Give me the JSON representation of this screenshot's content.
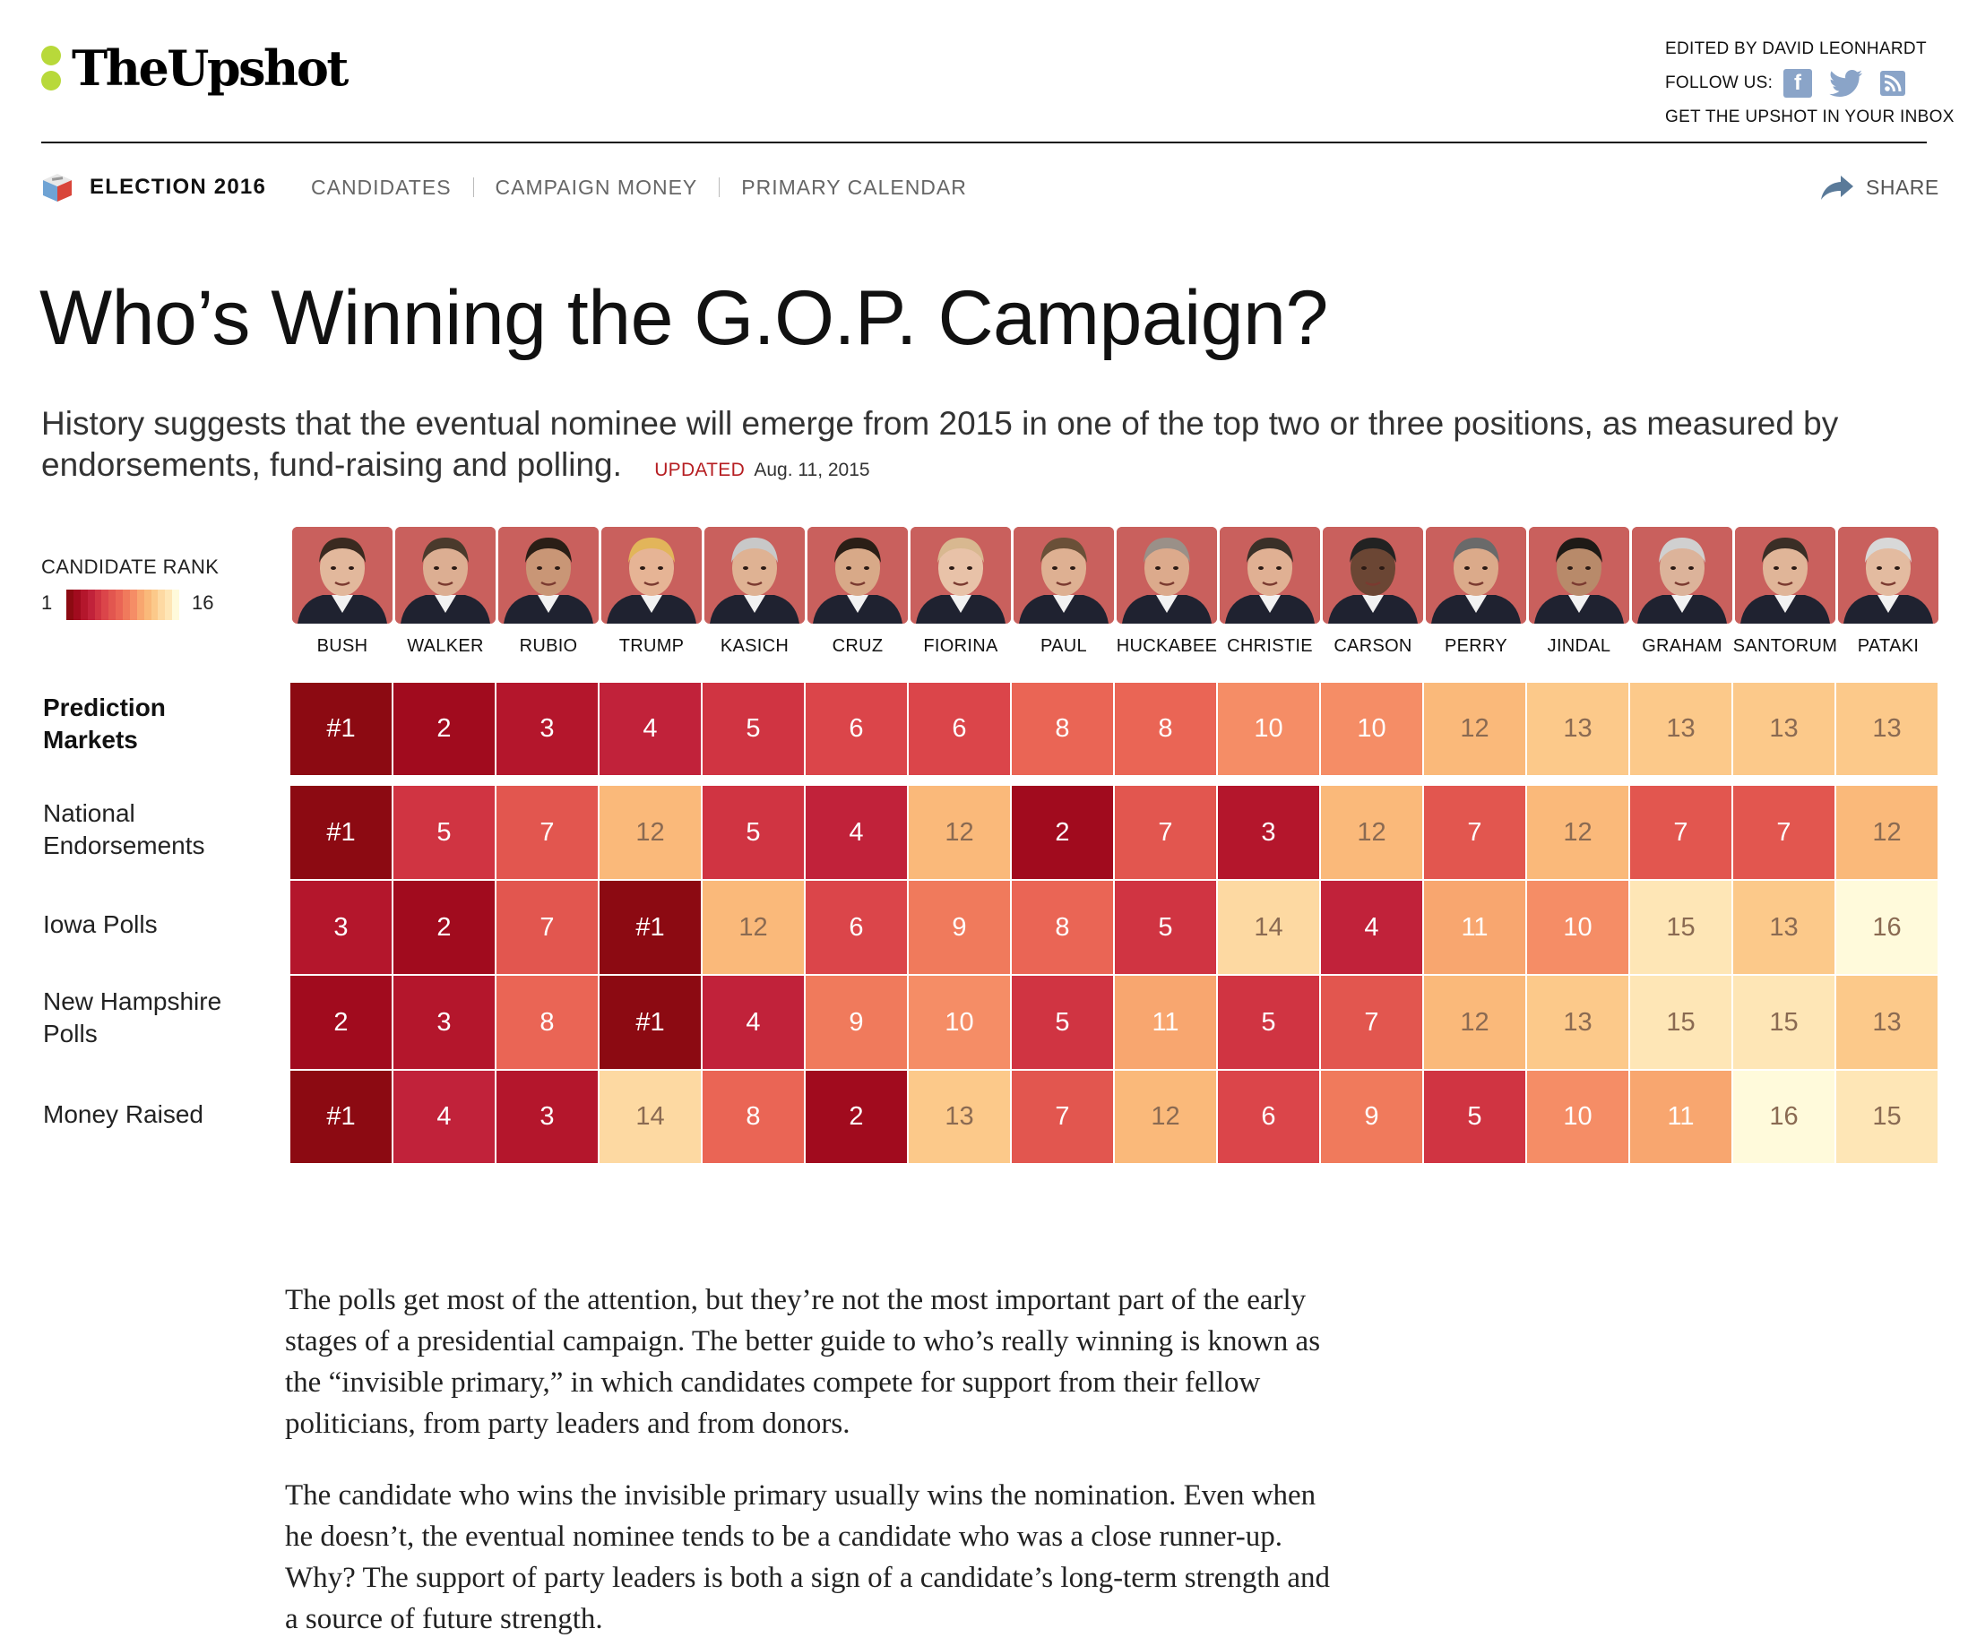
{
  "masthead": {
    "logo_text": "TheUpshot",
    "edited_by": "EDITED BY DAVID LEONHARDT",
    "follow_us": "FOLLOW US:",
    "facebook_glyph": "f",
    "inbox_link": "GET THE UPSHOT IN YOUR INBOX",
    "icons": [
      "facebook-icon",
      "twitter-icon",
      "rss-icon"
    ]
  },
  "nav": {
    "section": "ELECTION 2016",
    "links": [
      "CANDIDATES",
      "CAMPAIGN MONEY",
      "PRIMARY CALENDAR"
    ],
    "share": "SHARE"
  },
  "article": {
    "headline": "Who’s Winning the G.O.P. Campaign?",
    "summary": "History suggests that the eventual nominee will emerge from 2015 in one of the top two or three positions, as measured by endorsements, fund-raising and polling.",
    "updated_label": "UPDATED",
    "updated_date": "Aug. 11, 2015",
    "paragraphs": [
      "The polls get most of the attention, but they’re not the most important part of the early stages of a presidential campaign. The better guide to who’s really winning is known as the “invisible primary,” in which candidates compete for support from their fellow politicians, from party leaders and from donors.",
      "The candidate who wins the invisible primary usually wins the nomination. Even when he doesn’t, the eventual nominee tends to be a candidate who was a close runner-up. Why? The support of party leaders is both a sign of a candidate’s long-term strength and a source of future strength."
    ]
  },
  "legend": {
    "title": "CANDIDATE RANK",
    "min": "1",
    "max": "16"
  },
  "colors": {
    "rank_scale": [
      "#8c0a12",
      "#a10b1e",
      "#b4162c",
      "#c1223a",
      "#d03442",
      "#db454a",
      "#e2564f",
      "#ea6555",
      "#f07a5c",
      "#f58d66",
      "#f8a66f",
      "#fab97a",
      "#fcc98a",
      "#fdd9a2",
      "#fee6b6",
      "#fffadb"
    ],
    "dark_text": "#ffffff",
    "light_text": "#8a6a52",
    "accent_green": "#b8d93a",
    "updated_red": "#b61e22"
  },
  "chart_data": {
    "type": "heatmap",
    "title": "Who’s Winning the G.O.P. Campaign?",
    "value_meaning": "CANDIDATE RANK",
    "scale_range": [
      1,
      16
    ],
    "candidates": [
      "BUSH",
      "WALKER",
      "RUBIO",
      "TRUMP",
      "KASICH",
      "CRUZ",
      "FIORINA",
      "PAUL",
      "HUCKABEE",
      "CHRISTIE",
      "CARSON",
      "PERRY",
      "JINDAL",
      "GRAHAM",
      "SANTORUM",
      "PATAKI"
    ],
    "rows": [
      {
        "label": "Prediction Markets",
        "bold": true,
        "values": [
          1,
          2,
          3,
          4,
          5,
          6,
          6,
          8,
          8,
          10,
          10,
          12,
          13,
          13,
          13,
          13
        ],
        "display": [
          "#1",
          "2",
          "3",
          "4",
          "5",
          "6",
          "6",
          "8",
          "8",
          "10",
          "10",
          "12",
          "13",
          "13",
          "13",
          "13"
        ]
      },
      {
        "label": "National Endorsements",
        "bold": false,
        "values": [
          1,
          5,
          7,
          12,
          5,
          4,
          12,
          2,
          7,
          3,
          12,
          7,
          12,
          7,
          7,
          12
        ],
        "display": [
          "#1",
          "5",
          "7",
          "12",
          "5",
          "4",
          "12",
          "2",
          "7",
          "3",
          "12",
          "7",
          "12",
          "7",
          "7",
          "12"
        ]
      },
      {
        "label": "Iowa Polls",
        "bold": false,
        "values": [
          3,
          2,
          7,
          1,
          12,
          6,
          9,
          8,
          5,
          14,
          4,
          11,
          10,
          15,
          13,
          16
        ],
        "display": [
          "3",
          "2",
          "7",
          "#1",
          "12",
          "6",
          "9",
          "8",
          "5",
          "14",
          "4",
          "11",
          "10",
          "15",
          "13",
          "16"
        ]
      },
      {
        "label": "New Hampshire Polls",
        "bold": false,
        "values": [
          2,
          3,
          8,
          1,
          4,
          9,
          10,
          5,
          11,
          5,
          7,
          12,
          13,
          15,
          15,
          13
        ],
        "display": [
          "2",
          "3",
          "8",
          "#1",
          "4",
          "9",
          "10",
          "5",
          "11",
          "5",
          "7",
          "12",
          "13",
          "15",
          "15",
          "13"
        ]
      },
      {
        "label": "Money Raised",
        "bold": false,
        "values": [
          1,
          4,
          3,
          14,
          8,
          2,
          13,
          7,
          12,
          6,
          9,
          5,
          10,
          11,
          16,
          15
        ],
        "display": [
          "#1",
          "4",
          "3",
          "14",
          "8",
          "2",
          "13",
          "7",
          "12",
          "6",
          "9",
          "5",
          "10",
          "11",
          "16",
          "15"
        ]
      }
    ]
  }
}
